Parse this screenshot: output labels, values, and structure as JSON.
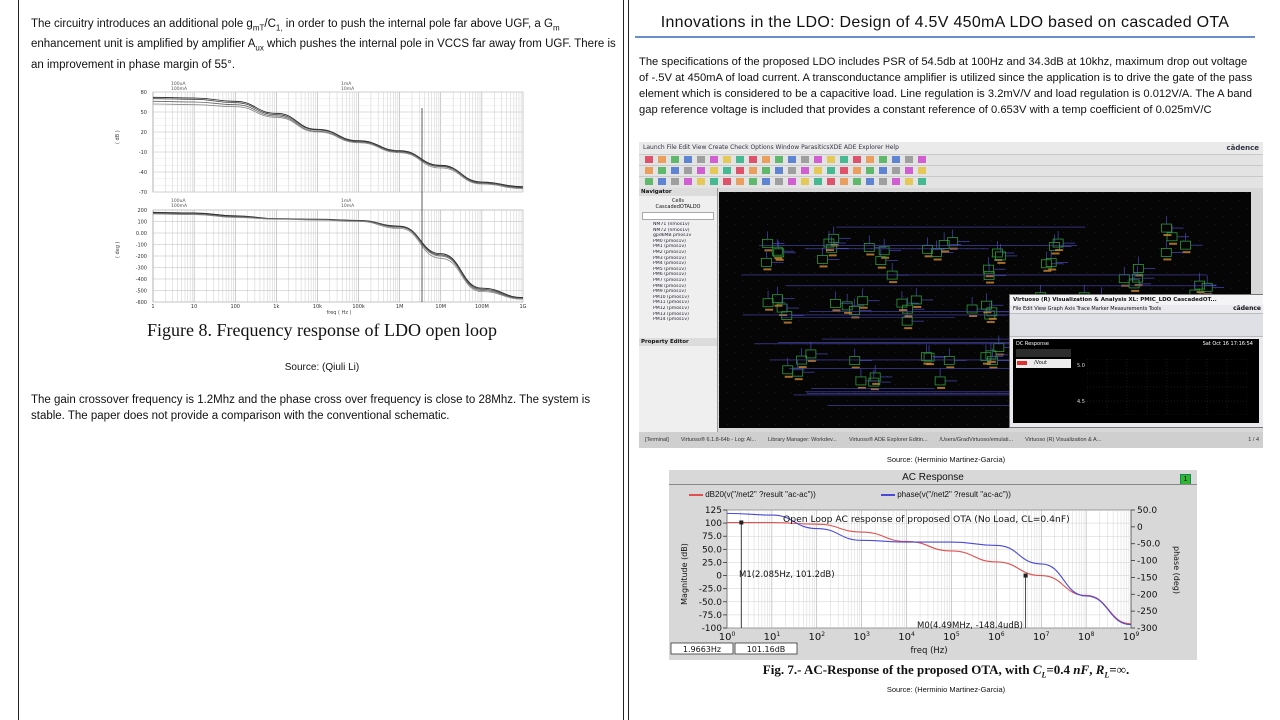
{
  "left": {
    "intro_parts": {
      "p1": "The circuitry introduces an additional pole g",
      "sub1": "mT",
      "p2": "/C",
      "sub2": "1,",
      "p3": " in order to push the internal pole far above UGF, a G",
      "sub3": "m",
      "p4": " enhancement unit is amplified by amplifier A",
      "sub4": "ux",
      "p5": " which pushes the internal pole in VCCS far away from UGF.  There is an improvement in phase margin of 55°."
    },
    "figure": {
      "caption": "Figure 8. Frequency response of LDO open loop",
      "mag_yticks": [
        "80",
        "50",
        "20",
        "-10",
        "-40",
        "-70"
      ],
      "phase_yticks": [
        "200",
        "100",
        "0.00",
        "-100",
        "-200",
        "-300",
        "-400",
        "-500",
        "-600"
      ],
      "xticks": [
        "1",
        "10",
        "100",
        "1k",
        "10k",
        "100k",
        "1M",
        "10M",
        "100M",
        "1G"
      ],
      "xlabel": "freq ( Hz )",
      "mag_ylabel": "( dB )",
      "phase_ylabel": "( deg )",
      "legend_mag_l1": "100uA",
      "legend_mag_l2": "100mA",
      "legend_mag_r1": "1mA",
      "legend_mag_r2": "10mA",
      "legend_ph_l1": "100uA",
      "legend_ph_l2": "100mA",
      "legend_ph_r1": "1mA",
      "legend_ph_r2": "10mA"
    },
    "source": "Source: (Qiuli Li)",
    "conclusion": "The gain crossover frequency is 1.2Mhz and the phase cross over frequency is close to 28Mhz.  The system is stable. The paper does not provide a comparison with the conventional schematic."
  },
  "right": {
    "title": "Innovations in the LDO: Design of 4.5V 450mA LDO based on cascaded OTA",
    "spec": "The specifications of the proposed LDO includes PSR of 54.5db at 100Hz and 34.3dB at 10khz, maximum drop out voltage of -.5V at 450mA of load current.  A transconductance amplifier is utilized since the application is to drive the gate of the pass element which is considered to be a capacitive load. Line regulation is 3.2mV/V and load regulation is 0.012V/A. The A band gap reference voltage is included that provides a constant reference of 0.653V with a temp coefficient of 0.025mV/C",
    "cadence": {
      "menu": "Launch  File  Edit  View  Create  Check  Options  Window  ParasiticsXDE  ADE Explorer  Help",
      "logo": "cādence",
      "navigator": "Navigator",
      "cells_header": "Cells",
      "cell_name": "CascadedOTALDO",
      "tree_items": [
        "NM71 (nmos1v)",
        "NM72 (nmos1v)",
        "gpdkMB pmos1v",
        "PM0 (pmos1v)",
        "PM1 (pmos1v)",
        "PM2 (pmos1v)",
        "PM3 (pmos1v)",
        "PM4 (pmos1v)",
        "PM5 (pmos1v)",
        "PM6 (pmos1v)",
        "PM7 (pmos1v)",
        "PM8 (pmos1v)",
        "PM9 (pmos1v)",
        "PM10 (pmos1v)",
        "PM11 (pmos1v)",
        "PM12 (pmos1v)",
        "PM13 (pmos1v)",
        "PM14 (pmos1v)"
      ],
      "property_editor": "Property Editor",
      "virt_title": "Virtuoso (R) Visualization & Analysis XL: PMIC_LDO CascadedOT...",
      "virt_logo": "cādence",
      "virt_menu": "File  Edit  View  Graph  Axis  Trace  Marker  Measurements  Tools",
      "dc_response": "DC Response",
      "vout": "/Vout",
      "v50": "5.0",
      "v45": "4.5",
      "date": "Sat Oct 16 17:16:54",
      "taskbar": [
        "[Terminal]",
        "Virtuoso® 6.1.8-64b - Log: Al...",
        "Library Manager: Workdev...",
        "Virtuoso® ADE Explorer Editin...",
        "/Users/GradVirtuoso/emulati...",
        "Virtuoso (R) Visualization & A..."
      ],
      "page_counter": "1 / 4"
    },
    "source1": "Source: (Herminio Martinez-Garcia)",
    "ac": {
      "title": "AC Response",
      "legend1": "dB20(v(\"/net2\" ?result \"ac-ac\"))",
      "legend2": "phase(v(\"/net2\" ?result \"ac-ac\"))",
      "plot_title": "Open Loop AC response of proposed OTA (No Load, CL=0.4nF)",
      "ylabel_left": "Magnitude (dB)",
      "ylabel_right": "phase (deg)",
      "xlabel": "freq (Hz)",
      "yticks_left": [
        "125",
        "100",
        "75.0",
        "50.0",
        "25.0",
        "0",
        "-25.0",
        "-50.0",
        "-75.0",
        "-100"
      ],
      "yticks_right": [
        "50.0",
        "0",
        "-50.0",
        "-100",
        "-150",
        "-200",
        "-250",
        "-300"
      ],
      "xtick_mantissa": "10",
      "xtick_exps": [
        "0",
        "1",
        "2",
        "3",
        "4",
        "5",
        "6",
        "7",
        "8",
        "9"
      ],
      "marker1": "M1(2.085Hz, 101.2dB)",
      "marker0": "M0(4.49MHz, -148.4udB)",
      "readout1": "1.9663Hz",
      "readout2": "101.16dB",
      "badge": "1"
    },
    "fig_caption": {
      "prefix": "Fig. 7.- AC-Response of the proposed OTA, with ",
      "cl_sym": "C",
      "cl_sub": "L",
      "cl_val": "=0.4 ",
      "cl_unit": "nF",
      "sep": ", ",
      "rl_sym": "R",
      "rl_sub": "L",
      "rl_val": "=∞."
    },
    "source2": "Source: (Herminio Martinez-Garcia)"
  },
  "colors": {
    "mag_trace": "#e05050",
    "phase_trace": "#4a4ad8",
    "title_rule": "#6a8ec9",
    "badge": "#2fb52f"
  },
  "chart_data": [
    {
      "type": "line",
      "title": "Figure 8. Frequency response of LDO open loop",
      "xlabel": "freq ( Hz )",
      "ylabel": "( dB )",
      "x_scale": "log",
      "x": [
        1,
        10,
        100,
        1000,
        10000,
        100000,
        1000000,
        10000000,
        100000000,
        1000000000
      ],
      "ylim": [
        -70,
        80
      ],
      "series": [
        {
          "name": "100uA",
          "values": [
            72,
            71,
            66,
            48,
            24,
            7,
            -8,
            -30,
            -55,
            -62
          ]
        },
        {
          "name": "1mA",
          "values": [
            70,
            69,
            64,
            46,
            23,
            6,
            -9,
            -31,
            -56,
            -63
          ]
        },
        {
          "name": "10mA",
          "values": [
            66,
            65,
            61,
            44,
            21,
            5,
            -10,
            -32,
            -57,
            -64
          ]
        },
        {
          "name": "100mA",
          "values": [
            62,
            61,
            58,
            42,
            20,
            4,
            -11,
            -34,
            -58,
            -65
          ]
        }
      ]
    },
    {
      "type": "line",
      "title": "",
      "xlabel": "freq ( Hz )",
      "ylabel": "( deg )",
      "x_scale": "log",
      "x": [
        1,
        10,
        100,
        1000,
        10000,
        100000,
        1000000,
        10000000,
        100000000,
        1000000000
      ],
      "ylim": [
        -600,
        200
      ],
      "series": [
        {
          "name": "100uA",
          "values": [
            180,
            175,
            150,
            125,
            120,
            110,
            60,
            -180,
            -480,
            -560
          ]
        },
        {
          "name": "1mA",
          "values": [
            175,
            170,
            145,
            125,
            118,
            108,
            55,
            -190,
            -490,
            -565
          ]
        },
        {
          "name": "10mA",
          "values": [
            170,
            165,
            140,
            122,
            116,
            104,
            50,
            -200,
            -500,
            -570
          ]
        },
        {
          "name": "100mA",
          "values": [
            165,
            160,
            135,
            120,
            112,
            100,
            40,
            -220,
            -510,
            -575
          ]
        }
      ]
    },
    {
      "type": "line",
      "title": "Open Loop AC response of proposed OTA (No Load, CL=0.4nF)",
      "xlabel": "freq (Hz)",
      "ylabel": "Magnitude (dB)",
      "x_scale": "log",
      "x": [
        1,
        10,
        100,
        1000,
        10000,
        100000,
        1000000,
        10000000,
        100000000,
        1000000000
      ],
      "ylim": [
        -100,
        125
      ],
      "series": [
        {
          "name": "dB20(v(\"/net2\" ?result \"ac-ac\"))",
          "values": [
            101,
            101,
            98,
            83,
            65,
            47,
            26,
            0,
            -38,
            -92
          ]
        },
        {
          "name": "phase(v(\"/net2\" ?result \"ac-ac\"))",
          "values": [
            40,
            35,
            -5,
            -40,
            -45,
            -45,
            -55,
            -110,
            -205,
            -290
          ]
        }
      ]
    }
  ]
}
